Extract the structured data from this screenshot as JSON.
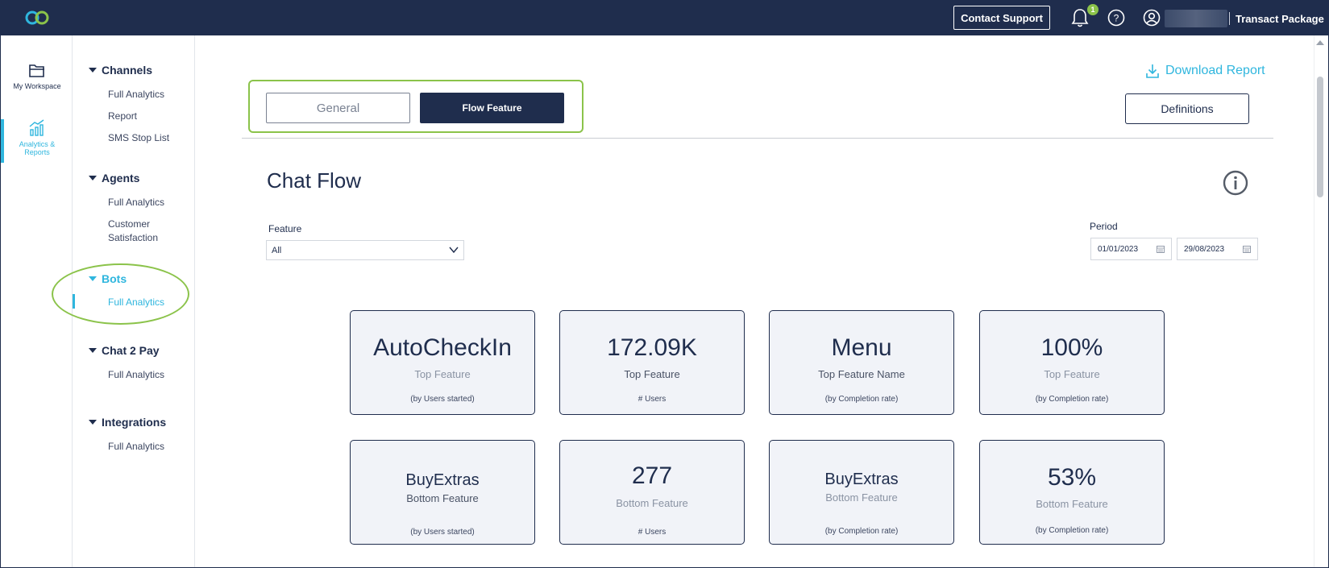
{
  "header": {
    "contact_support": "Contact Support",
    "notification_count": "1",
    "package": "Transact Package"
  },
  "rail": {
    "workspace": "My Workspace",
    "analytics_line1": "Analytics &",
    "analytics_line2": "Reports"
  },
  "sidebar": {
    "channels": {
      "title": "Channels",
      "items": [
        "Full Analytics",
        "Report",
        "SMS Stop List"
      ]
    },
    "agents": {
      "title": "Agents",
      "items": [
        "Full Analytics",
        "Customer",
        "Satisfaction"
      ]
    },
    "bots": {
      "title": "Bots",
      "items": [
        "Full Analytics"
      ]
    },
    "chat2pay": {
      "title": "Chat 2 Pay",
      "items": [
        "Full Analytics"
      ]
    },
    "integrations": {
      "title": "Integrations",
      "items": [
        "Full Analytics"
      ]
    }
  },
  "main": {
    "download_report": "Download Report",
    "tabs": {
      "general": "General",
      "flow_feature": "Flow Feature"
    },
    "definitions": "Definitions",
    "title": "Chat Flow",
    "feature": {
      "label": "Feature",
      "value": "All"
    },
    "period": {
      "label": "Period",
      "from": "01/01/2023",
      "to": "29/08/2023"
    },
    "cards": [
      {
        "value": "AutoCheckIn",
        "label": "Top Feature",
        "sub": "(by Users started)"
      },
      {
        "value": "172.09K",
        "label": "Top Feature",
        "sub": "# Users"
      },
      {
        "value": "Menu",
        "label": "Top Feature Name",
        "sub": "(by Completion rate)"
      },
      {
        "value": "100%",
        "label": "Top Feature",
        "sub": "(by Completion rate)"
      },
      {
        "value": "BuyExtras",
        "label": "Bottom Feature",
        "sub": "(by Users started)"
      },
      {
        "value": "277",
        "label": "Bottom Feature",
        "sub": "# Users"
      },
      {
        "value": "BuyExtras",
        "label": "Bottom Feature",
        "sub": "(by Completion rate)"
      },
      {
        "value": "53%",
        "label": "Bottom Feature",
        "sub": "(by Completion rate)"
      }
    ]
  },
  "colors": {
    "navy": "#1f2d4d",
    "accent": "#2fb6de",
    "highlight": "#8bc34a"
  }
}
